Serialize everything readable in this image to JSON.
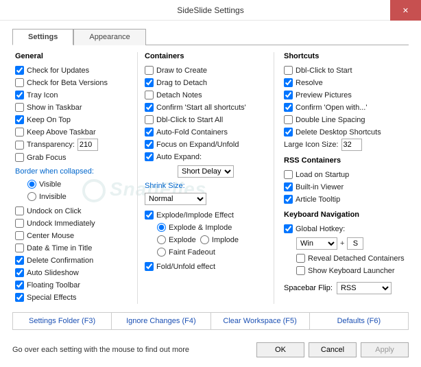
{
  "title": "SideSlide Settings",
  "tabs": {
    "settings": "Settings",
    "appearance": "Appearance"
  },
  "general": {
    "title": "General",
    "check_updates": "Check for Updates",
    "check_beta": "Check for Beta Versions",
    "tray_icon": "Tray Icon",
    "show_taskbar": "Show in Taskbar",
    "keep_on_top": "Keep On Top",
    "keep_above_taskbar": "Keep Above Taskbar",
    "transparency": "Transparency:",
    "transparency_val": "210",
    "grab_focus": "Grab Focus",
    "border_collapsed": "Border when collapsed:",
    "visible": "Visible",
    "invisible": "Invisible",
    "undock_click": "Undock on Click",
    "undock_immediately": "Undock Immediately",
    "center_mouse": "Center Mouse",
    "date_time_title": "Date & Time in Title",
    "delete_confirmation": "Delete Confirmation",
    "auto_slideshow": "Auto Slideshow",
    "floating_toolbar": "Floating Toolbar",
    "special_effects": "Special Effects"
  },
  "containers": {
    "title": "Containers",
    "draw_create": "Draw to Create",
    "drag_detach": "Drag to Detach",
    "detach_notes": "Detach Notes",
    "confirm_start_all": "Confirm 'Start all shortcuts'",
    "dblclick_start_all": "Dbl-Click to Start All",
    "autofold": "Auto-Fold Containers",
    "focus_expand": "Focus on Expand/Unfold",
    "auto_expand": "Auto Expand:",
    "auto_expand_val": "Short Delay",
    "shrink_size": "Shrink Size:",
    "shrink_val": "Normal",
    "explode_effect": "Explode/Implode Effect",
    "explode_implode": "Explode & Implode",
    "explode": "Explode",
    "implode": "Implode",
    "faint_fadeout": "Faint Fadeout",
    "fold_unfold": "Fold/Unfold effect"
  },
  "shortcuts": {
    "title": "Shortcuts",
    "dblclick_start": "Dbl-Click to Start",
    "resolve": "Resolve",
    "preview_pictures": "Preview Pictures",
    "confirm_openwith": "Confirm 'Open with...'",
    "double_line_spacing": "Double Line Spacing",
    "delete_desktop": "Delete Desktop Shortcuts",
    "large_icon": "Large Icon Size:",
    "large_icon_val": "32"
  },
  "rss": {
    "title": "RSS Containers",
    "load_startup": "Load on Startup",
    "builtin_viewer": "Built-in Viewer",
    "article_tooltip": "Article Tooltip"
  },
  "keynav": {
    "title": "Keyboard Navigation",
    "global_hotkey": "Global Hotkey:",
    "mod": "Win",
    "key": "S",
    "reveal_detached": "Reveal Detached Containers",
    "show_launcher": "Show Keyboard Launcher",
    "spacebar_flip": "Spacebar Flip:",
    "spacebar_val": "RSS"
  },
  "bottom": {
    "settings_folder": "Settings Folder (F3)",
    "ignore_changes": "Ignore Changes (F4)",
    "clear_workspace": "Clear Workspace (F5)",
    "defaults": "Defaults (F6)"
  },
  "footer": {
    "hint": "Go over each setting with the mouse to find out more",
    "ok": "OK",
    "cancel": "Cancel",
    "apply": "Apply"
  }
}
